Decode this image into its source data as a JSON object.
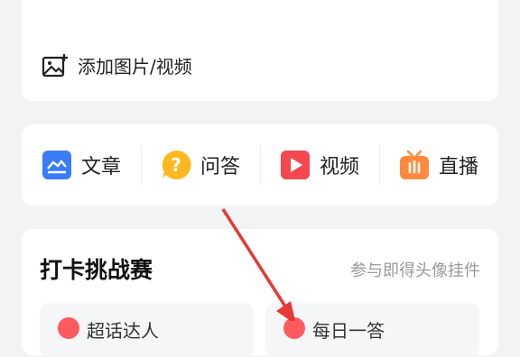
{
  "composer": {
    "add_media_label": "添加图片/视频"
  },
  "actions": [
    {
      "label": "文章",
      "icon": "article-icon",
      "color": "#3b7cf6"
    },
    {
      "label": "问答",
      "icon": "question-icon",
      "color": "#ffb81f"
    },
    {
      "label": "视频",
      "icon": "video-icon",
      "color": "#f4474e"
    },
    {
      "label": "直播",
      "icon": "live-tv-icon",
      "color": "#ff8a3d"
    }
  ],
  "challenge": {
    "title": "打卡挑战赛",
    "subtitle": "参与即得头像挂件",
    "tiles": [
      "超话达人",
      "每日一答"
    ]
  },
  "colors": {
    "annotation_arrow": "#e53935",
    "background": "#f2f3f5"
  }
}
